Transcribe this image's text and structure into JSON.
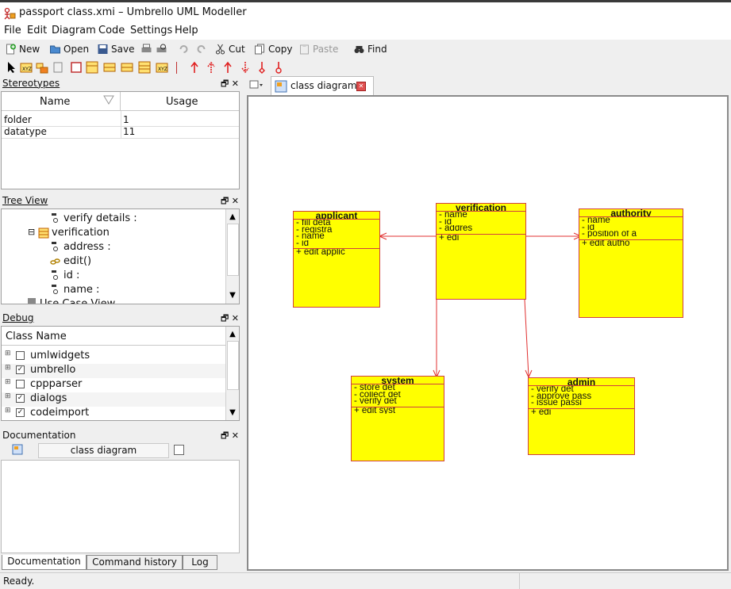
{
  "window": {
    "title": "passport class.xmi – Umbrello UML Modeller"
  },
  "menu": [
    "File",
    "Edit",
    "Diagram",
    "Code",
    "Settings",
    "Help"
  ],
  "toolbar": {
    "new": "New",
    "open": "Open",
    "save": "Save",
    "cut": "Cut",
    "copy": "Copy",
    "paste": "Paste",
    "find": "Find"
  },
  "stereotypes": {
    "title": "Stereotypes",
    "col_name": "Name",
    "col_usage": "Usage",
    "rows": [
      {
        "name": "folder",
        "usage": "1"
      },
      {
        "name": "datatype",
        "usage": "11"
      }
    ]
  },
  "treeview": {
    "title": "Tree View",
    "items": [
      {
        "label": "verify details :"
      },
      {
        "label": "verification"
      },
      {
        "label": "address :"
      },
      {
        "label": "edit()"
      },
      {
        "label": "id :"
      },
      {
        "label": "name :"
      },
      {
        "label": "Use Case View"
      }
    ]
  },
  "debug": {
    "title": "Debug",
    "col": "Class Name",
    "rows": [
      {
        "label": "umlwidgets",
        "checked": false
      },
      {
        "label": "umbrello",
        "checked": true
      },
      {
        "label": "cppparser",
        "checked": false
      },
      {
        "label": "dialogs",
        "checked": true
      },
      {
        "label": "codeimport",
        "checked": true
      }
    ]
  },
  "documentation": {
    "title": "Documentation",
    "diagram_name": "class diagram"
  },
  "bottom_tabs": [
    "Documentation",
    "Command history",
    "Log"
  ],
  "diagram_tab": {
    "label": "class diagram"
  },
  "classes": {
    "applicant": {
      "name": "applicant",
      "attrs": [
        "- fill deta",
        "- registra",
        "- name",
        "- id"
      ],
      "ops": [
        "+ edit applic"
      ]
    },
    "verification": {
      "name": "verification",
      "attrs": [
        "- name",
        "- id",
        "- addres"
      ],
      "ops": [
        "+ edi"
      ]
    },
    "authority": {
      "name": "authority",
      "attrs": [
        "- name",
        "- id",
        "- position of a"
      ],
      "ops": [
        "+ edit autho"
      ]
    },
    "system": {
      "name": "system",
      "attrs": [
        "- store det",
        "- collect det",
        "- verify det"
      ],
      "ops": [
        "+ edit syst"
      ]
    },
    "admin": {
      "name": "admin",
      "attrs": [
        "- verify det",
        "- approve pass",
        "- issue passi"
      ],
      "ops": [
        "+ edi"
      ]
    }
  },
  "status": {
    "text": "Ready."
  },
  "colors": {
    "class_fill": "#ffff00",
    "class_border": "#d04040",
    "arrow": "#e03030"
  }
}
